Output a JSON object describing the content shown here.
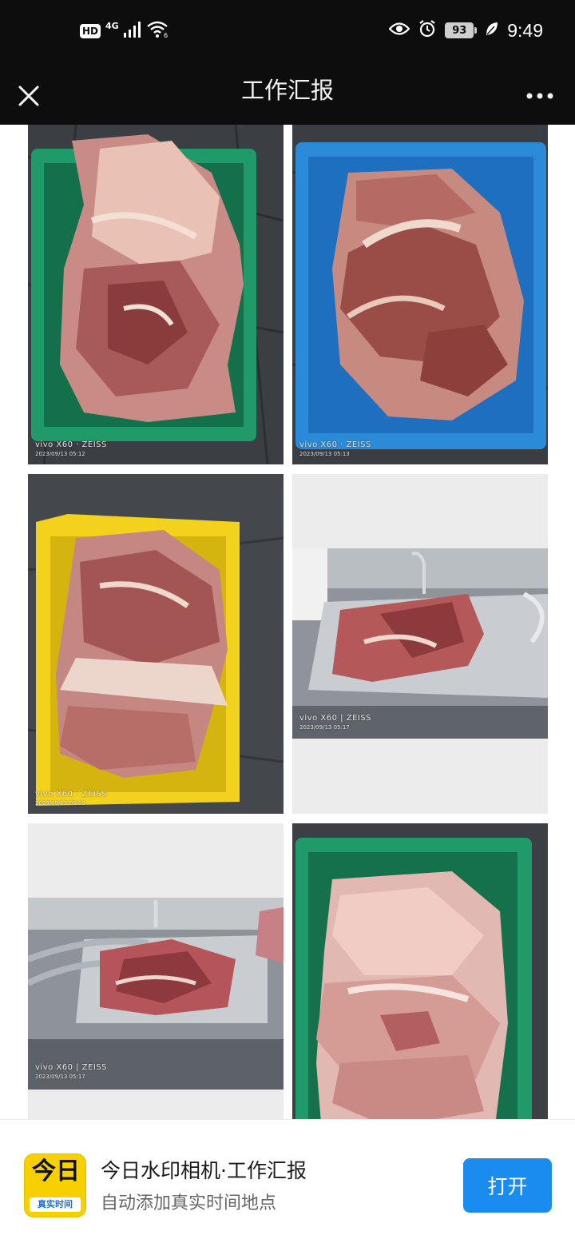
{
  "status_bar": {
    "hd_label": "HD",
    "network_label": "4G",
    "wifi_label": "6",
    "battery_level": "93",
    "time": "9:49",
    "icons": [
      "signal-icon",
      "wifi-icon",
      "eye-icon",
      "alarm-icon",
      "battery-icon",
      "leaf-icon"
    ]
  },
  "nav": {
    "title": "工作汇报",
    "close_icon": "close-icon",
    "more_icon": "more-icon"
  },
  "photos": [
    {
      "brand": "vivo X60 · ZEISS",
      "date": "2023/09/13 05:12",
      "basket_color": "#1f9a68"
    },
    {
      "brand": "vivo X60 · ZEISS",
      "date": "2023/09/13 05:13",
      "basket_color": "#2b8bd8"
    },
    {
      "brand": "vivo X60 · ZEISS",
      "date": "2023/09/13 05:09",
      "basket_color": "#f2d21c"
    },
    {
      "brand": "vivo X60 | ZEISS",
      "date": "2023/09/13 05:17",
      "basket_color": "#c9cdd1"
    },
    {
      "brand": "vivo X60 | ZEISS",
      "date": "2023/09/13 05:17",
      "basket_color": "#c9cdd1"
    },
    {
      "brand": "",
      "date": "",
      "basket_color": "#1f9a68"
    }
  ],
  "app_banner": {
    "icon_top": "今日",
    "icon_bottom": "真实时间",
    "name": "今日水印相机·工作汇报",
    "description": "自动添加真实时间地点",
    "open_label": "打开",
    "accent": "#1a8cf0"
  }
}
